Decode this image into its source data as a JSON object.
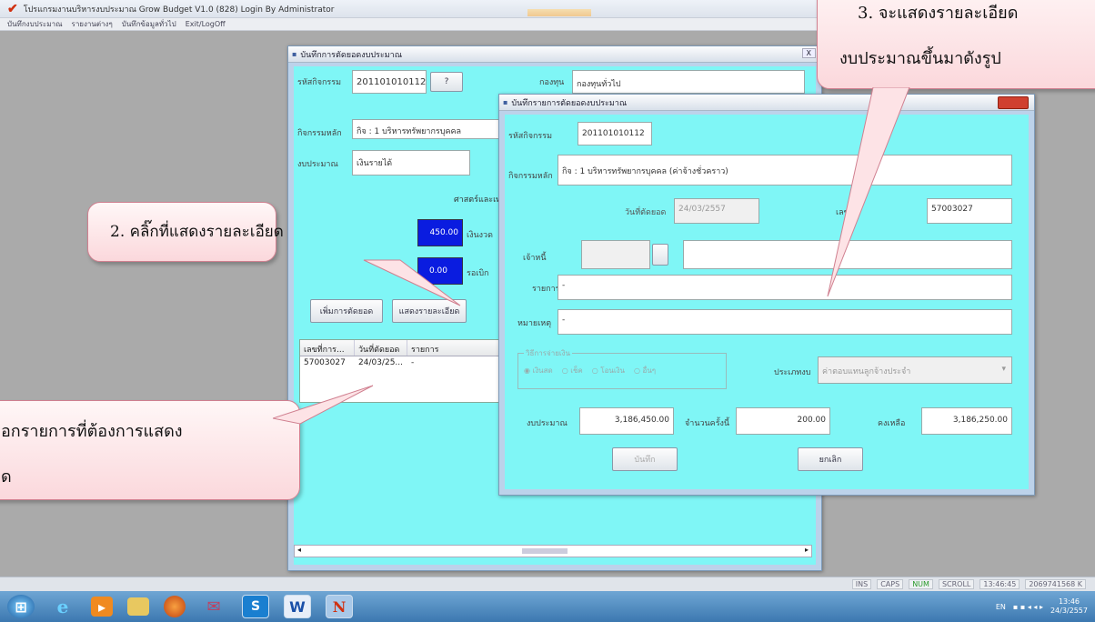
{
  "app": {
    "title": "โปรแกรมงานบริหารงบประมาณ Grow Budget V1.0 (828) Login By Administrator",
    "menu": [
      "บันทึกงบประมาณ",
      "รายงานต่างๆ",
      "บันทึกข้อมูลทั่วไป",
      "Exit/LogOff"
    ]
  },
  "main_window": {
    "title": "บันทึกการตัดยอดงบประมาณ",
    "close": "X",
    "activity_code_label": "รหัสกิจกรรม",
    "activity_code": "201101010112",
    "lookup_btn": "?",
    "group_label": "กองทุน",
    "group_value": "กองทุนทั่วไป",
    "activity_label": "กิจกรรมหลัก",
    "activity_value": "กิจ : 1 บริหารทรัพยากรบุคคล",
    "budget_type_label": "งบประมาณ",
    "budget_type_value": "เงินรายได้",
    "project_value": "ศาสตร์และเทคโนโลยี",
    "amount1": "450.00",
    "amount1_label": "เงินงวด",
    "amount2": "0.00",
    "amount2_label": "รอเบิก",
    "cut_button": "เพิ่มการตัดยอด",
    "detail_button": "แสดงรายละเอียด",
    "grid_headers": [
      "เลขที่การ...",
      "วันที่ตัดยอด",
      "รายการ"
    ],
    "grid_rows": [
      [
        "57003027",
        "24/03/25...",
        "-"
      ]
    ]
  },
  "detail_window": {
    "title": "บันทึกรายการตัดยอดงบประมาณ",
    "activity_code_label": "รหัสกิจกรรม",
    "activity_code": "201101010112",
    "activity_label": "กิจกรรมหลัก",
    "activity_value": "กิจ : 1 บริหารทรัพยากรบุคคล (ค่าจ้างชั่วคราว)",
    "date_label": "วันที่ตัดยอด",
    "date_value": "24/03/2557",
    "doc_no_label": "เลขที่",
    "doc_no": "57003027",
    "creditor_label": "เจ้าหนี้",
    "list_label": "รายการ",
    "list_value": "-",
    "note_label": "หมายเหตุ",
    "note_value": "-",
    "radio_legend": "วิธีการจ่ายเงิน",
    "radio_options": [
      "เงินสด",
      "เช็ค",
      "โอนเงิน",
      "อื่นๆ"
    ],
    "budget_cat_label": "ประเภทงบ",
    "budget_cat_value": "ค่าตอบแทนลูกจ้างประจำ",
    "budget_label": "งบประมาณ",
    "budget_value": "3,186,450.00",
    "this_time_label": "จำนวนครั้งนี้",
    "this_time_value": "200.00",
    "remain_label": "คงเหลือ",
    "remain_value": "3,186,250.00",
    "save_btn": "บันทึก",
    "cancel_btn": "ยกเลิก"
  },
  "callouts": {
    "c1_line1": "อกรายการที่ต้องการแสดง",
    "c1_line2": "ด",
    "c2": "2. คลิ๊กที่แสดงรายละเอียด",
    "c3_line1": "3. จะแสดงรายละเอียด",
    "c3_line2": "งบประมาณขึ้นมาดังรูป"
  },
  "status": {
    "ins": "INS",
    "caps": "CAPS",
    "num": "NUM",
    "scroll": "SCROLL",
    "time": "13:46:45",
    "mem": "2069741568 K"
  },
  "tray": {
    "lang": "EN",
    "time": "13:46",
    "date": "24/3/2557"
  },
  "colors": {
    "form_bg": "#7ff6f6",
    "callout_border": "#d08090",
    "blue_box": "#0a1ce0"
  }
}
